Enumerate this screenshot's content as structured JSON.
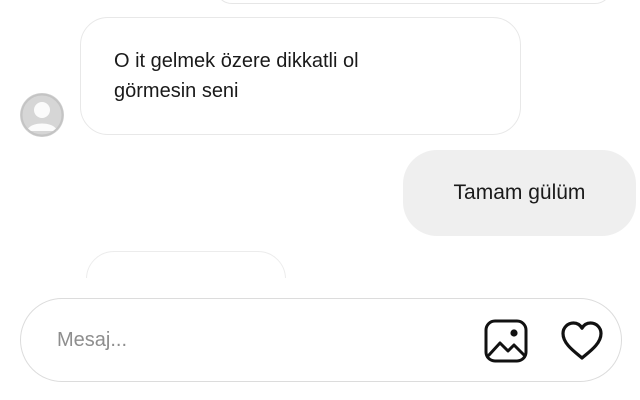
{
  "messages": [
    {
      "direction": "incoming",
      "lines": [
        "O it gelmek özere dikkatli ol",
        "görmesin seni"
      ]
    },
    {
      "direction": "outgoing",
      "text": "Tamam gülüm"
    }
  ],
  "avatar": {
    "icon": "default-profile-icon"
  },
  "composer": {
    "placeholder": "Mesaj...",
    "value": "",
    "icons": [
      "gallery-icon",
      "heart-icon"
    ]
  },
  "colors": {
    "incoming_bubble_border": "#e8e8e8",
    "outgoing_bubble_bg": "#efefef",
    "text": "#1a1a1a",
    "placeholder": "#8e8e8e"
  }
}
